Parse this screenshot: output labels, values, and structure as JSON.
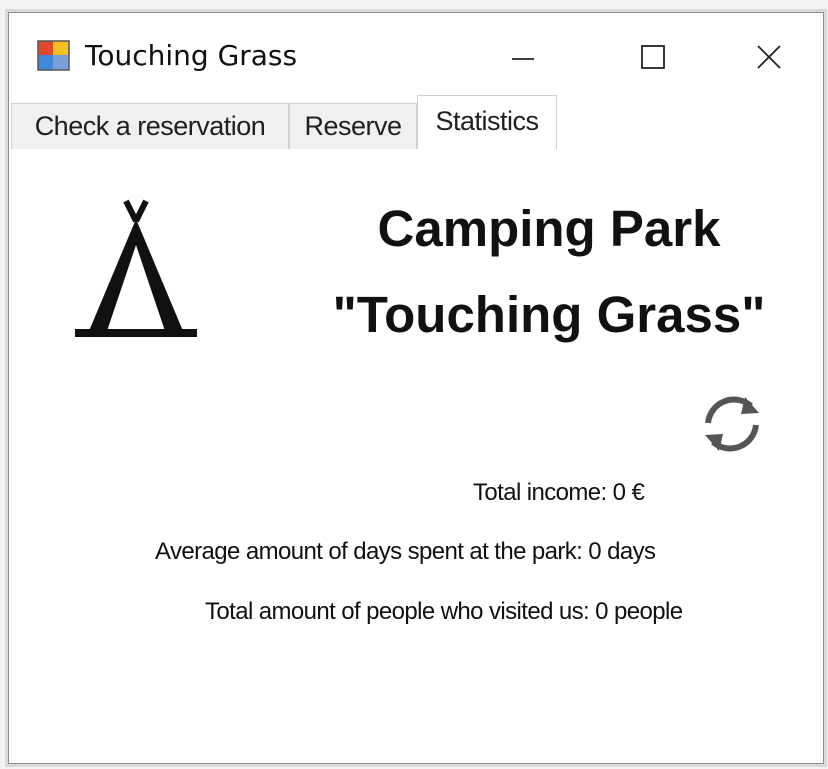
{
  "window": {
    "title": "Touching Grass",
    "controls": {
      "minimize": "minimize",
      "maximize": "maximize",
      "close": "close"
    }
  },
  "tabs": [
    {
      "label": "Check a reservation",
      "selected": false
    },
    {
      "label": "Reserve",
      "selected": false
    },
    {
      "label": "Statistics",
      "selected": true
    }
  ],
  "header": {
    "line1": "Camping Park",
    "line2": "\"Touching Grass\""
  },
  "icons": {
    "app": "app-window-icon",
    "tent": "tent-icon",
    "refresh": "refresh-icon"
  },
  "stats": {
    "income": "Total income: 0 €",
    "days": "Average amount of days spent at the park: 0 days",
    "people": "Total amount of people who visited us: 0 people"
  }
}
